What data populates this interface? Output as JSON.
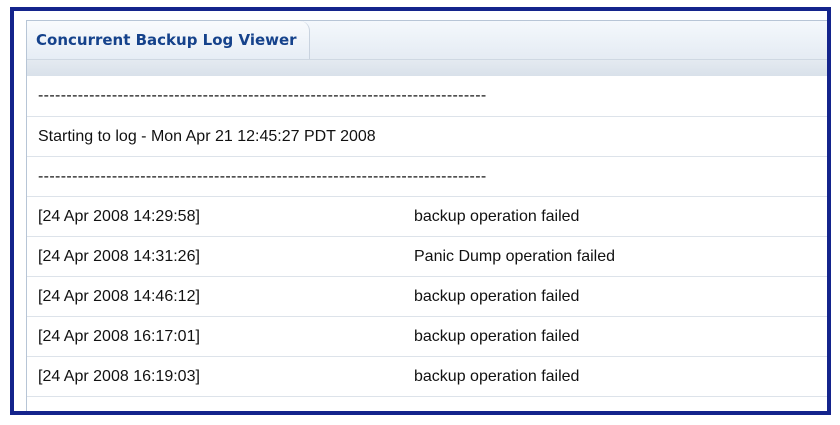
{
  "window": {
    "title": "Concurrent Backup Log Viewer"
  },
  "log": {
    "header_lines": [
      "-------------------------------------------------------------------------------",
      "Starting to log - Mon Apr 21 12:45:27 PDT 2008",
      "-------------------------------------------------------------------------------"
    ],
    "entries": [
      {
        "timestamp": "[24 Apr 2008 14:29:58]",
        "message": "backup operation failed"
      },
      {
        "timestamp": "[24 Apr 2008 14:31:26]",
        "message": "Panic Dump operation failed"
      },
      {
        "timestamp": "[24 Apr 2008 14:46:12]",
        "message": "backup operation failed"
      },
      {
        "timestamp": "[24 Apr 2008 16:17:01]",
        "message": "backup operation failed"
      },
      {
        "timestamp": "[24 Apr 2008 16:19:03]",
        "message": "backup operation failed"
      }
    ]
  },
  "colors": {
    "frame_border": "#14248c",
    "title_text": "#15428b"
  }
}
